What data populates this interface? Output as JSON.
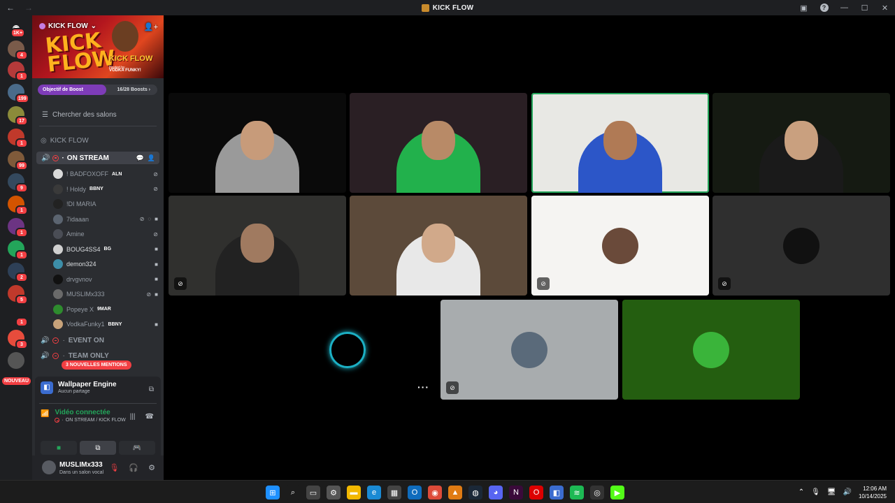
{
  "window": {
    "title": "KICK FLOW",
    "back": "←",
    "forward": "→"
  },
  "guilds": {
    "home_badge": "1K+",
    "nouveau_label": "NOUVEAU",
    "items": [
      {
        "badge": "4",
        "color": "#7a5b4a"
      },
      {
        "badge": "1",
        "color": "#b53a3a"
      },
      {
        "badge": "199",
        "color": "#4a6b8a"
      },
      {
        "badge": "17",
        "color": "#8b8b3a"
      },
      {
        "badge": "1",
        "color": "#c0392b"
      },
      {
        "badge": "99",
        "color": "#7f5a3a"
      },
      {
        "badge": "9",
        "color": "#34495e"
      },
      {
        "badge": "1",
        "color": "#d35400"
      },
      {
        "badge": "1",
        "color": "#6c3483"
      },
      {
        "badge": "1",
        "color": "#23a55a"
      },
      {
        "badge": "2",
        "color": "#2e4057"
      },
      {
        "badge": "5",
        "color": "#c0392b"
      },
      {
        "badge": "1",
        "color": "#1e1f22"
      },
      {
        "badge": "3",
        "color": "#e74c3c"
      },
      {
        "badge": "",
        "color": "#555"
      }
    ]
  },
  "server": {
    "name": "KICK FLOW",
    "banner_big": "KICK FLOW",
    "banner_small": "KICK FLOW",
    "banner_hosted": "Hosted by",
    "banner_host": "VODKA FUNKY!",
    "boost_label": "Objectif de Boost",
    "boost_count": "16/28 Boosts",
    "boost_fraction": 0.571,
    "search_channels": "Chercher des salons",
    "category": "KICK FLOW",
    "voice_channel": "ON STREAM",
    "mentions": "3 NOUVELLES MENTIONS"
  },
  "members": [
    {
      "name": "! BADFOXOFF",
      "tag": "ALN",
      "color": "#d9d9d9"
    },
    {
      "name": "! Holdy",
      "tag": "BBNY",
      "color": "#3a3a3a"
    },
    {
      "name": "!DI MARIA",
      "tag": "",
      "color": "#222"
    },
    {
      "name": "7idaaan",
      "tag": "",
      "color": "#5b6470"
    },
    {
      "name": "Amine",
      "tag": "",
      "color": "#4a4d55"
    },
    {
      "name": "BOUG4SS4",
      "tag": "BG",
      "color": "#d0d0d0"
    },
    {
      "name": "demon324",
      "tag": "",
      "color": "#3d8ea8"
    },
    {
      "name": "drvgvnov",
      "tag": "",
      "color": "#111"
    },
    {
      "name": "MUSLIMx333",
      "tag": "",
      "color": "#6a6a6a"
    },
    {
      "name": "Popeye X",
      "tag": "9MAR",
      "color": "#2e8b2e"
    },
    {
      "name": "VodkaFunky1",
      "tag": "BBNY",
      "color": "#c7a27a"
    }
  ],
  "categories": [
    "EVENT ON",
    "TEAM ONLY"
  ],
  "panel": {
    "app_name": "Wallpaper Engine",
    "app_status": "Aucun partage",
    "voice_status": "Vidéo connectée",
    "voice_location": "ON STREAM / KICK FLOW"
  },
  "user": {
    "name": "MUSLIMx333",
    "status": "Dans un salon vocal"
  },
  "tiles": [
    {
      "kind": "cam",
      "bg": "#0a0a0a",
      "skin": "#c79b7a",
      "shirt": "#9a9a9a",
      "muted": false
    },
    {
      "kind": "cam",
      "bg": "#2a1f24",
      "skin": "#b88a67",
      "shirt": "#22b14c",
      "muted": false
    },
    {
      "kind": "cam",
      "bg": "#e8e8e4",
      "skin": "#b07a55",
      "shirt": "#2c56c8",
      "muted": false
    },
    {
      "kind": "cam",
      "bg": "#151a12",
      "skin": "#c9a07f",
      "shirt": "#1a1a1a",
      "muted": false
    },
    {
      "kind": "cam",
      "bg": "#30302e",
      "skin": "#a07a60",
      "shirt": "#222",
      "muted": true
    },
    {
      "kind": "cam",
      "bg": "#5c4a3a",
      "skin": "#d1a98a",
      "shirt": "#e8e8e8",
      "muted": false
    },
    {
      "kind": "avatar",
      "bg": "#f5f4f2",
      "pfp": "#6a4a3a",
      "muted": true
    },
    {
      "kind": "avatar",
      "bg": "#2f2f2f",
      "pfp": "#111",
      "muted": true
    },
    {
      "kind": "avatar",
      "bg": "#000000",
      "pfp": "#1cb0c4",
      "muted": false
    },
    {
      "kind": "avatar",
      "bg": "#a8acae",
      "pfp": "#5a6a7a",
      "muted": true
    },
    {
      "kind": "avatar",
      "bg": "#245e10",
      "pfp": "#3ab43a",
      "muted": false
    }
  ],
  "tile_more": "···",
  "taskbar": {
    "icons": [
      {
        "name": "windows-start",
        "color": "#1e90ff"
      },
      {
        "name": "search",
        "color": "#1c1c1c"
      },
      {
        "name": "task-view",
        "color": "#444"
      },
      {
        "name": "settings",
        "color": "#555"
      },
      {
        "name": "file-explorer",
        "color": "#f2b800"
      },
      {
        "name": "edge",
        "color": "#1a8ad4"
      },
      {
        "name": "store",
        "color": "#444"
      },
      {
        "name": "outlook",
        "color": "#0f6cbd"
      },
      {
        "name": "chrome",
        "color": "#dd4b39"
      },
      {
        "name": "vlc",
        "color": "#e07b13"
      },
      {
        "name": "steam",
        "color": "#1b2838"
      },
      {
        "name": "discord",
        "color": "#5865f2"
      },
      {
        "name": "next",
        "color": "#3a0a3a"
      },
      {
        "name": "opera",
        "color": "#d00"
      },
      {
        "name": "wallpaper-engine",
        "color": "#3b6ccf"
      },
      {
        "name": "spotify",
        "color": "#1db954"
      },
      {
        "name": "app-alert",
        "color": "#333"
      },
      {
        "name": "kick",
        "color": "#53fc18"
      }
    ],
    "time": "12:06 AM",
    "date": "10/14/2025"
  }
}
